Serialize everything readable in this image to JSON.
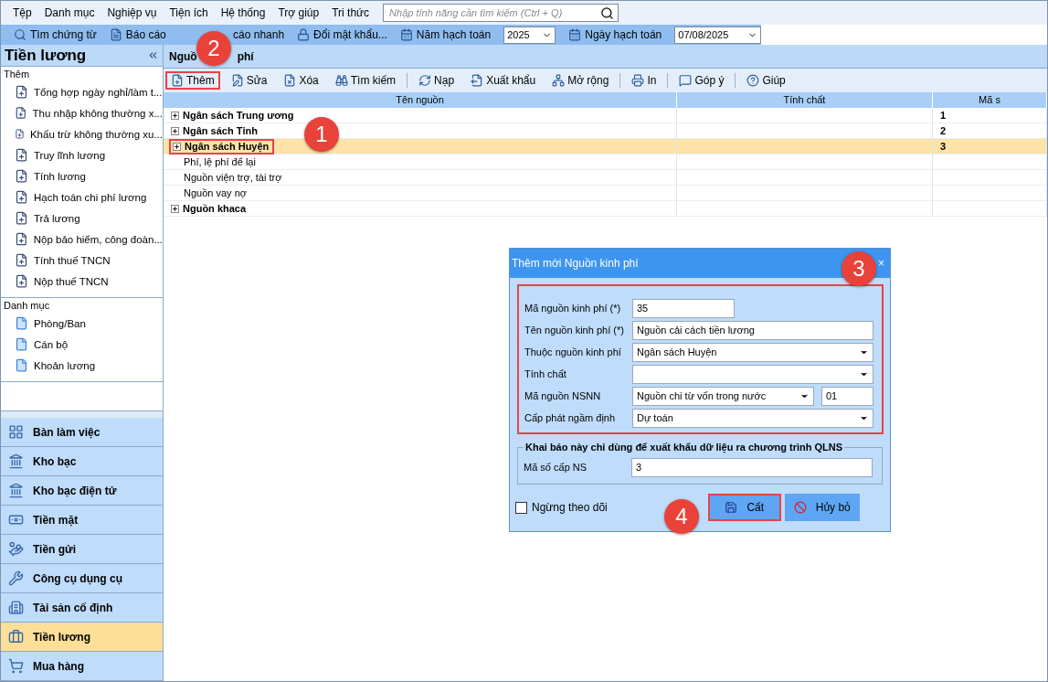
{
  "menu": {
    "items": [
      "Tệp",
      "Danh mục",
      "Nghiệp vụ",
      "Tiện ích",
      "Hệ thống",
      "Trợ giúp",
      "Tri thức"
    ],
    "search": {
      "placeholder": "Nhập tính năng cần tìm kiếm (Ctrl + Q)"
    }
  },
  "toolbar": [
    {
      "kind": "button",
      "label": "Tìm chứng từ"
    },
    {
      "kind": "button",
      "label": "Báo cáo"
    },
    {
      "kind": "covered",
      "label": "cáo nhanh"
    },
    {
      "kind": "button",
      "label": "Đổi mật khẩu..."
    },
    {
      "kind": "combo",
      "label": "Năm hạch toán",
      "value": "2025"
    },
    {
      "kind": "combo",
      "label": "Ngày hạch toán",
      "value": "07/08/2025"
    }
  ],
  "sidebar": {
    "title": "Tiền lương",
    "groups": [
      {
        "heading": "Thêm",
        "items": [
          "Tổng hợp ngày nghỉ/làm t...",
          "Thu nhập không thường x...",
          "Khấu trừ không thường xu...",
          "Truy lĩnh lương",
          "Tính lương",
          "Hạch toán chi phí lương",
          "Trả lương",
          "Nộp bảo hiểm, công đoàn...",
          "Tính thuế TNCN",
          "Nộp thuế TNCN"
        ]
      },
      {
        "heading": "Danh mục",
        "items": [
          "Phòng/Ban",
          "Cán bộ",
          "Khoản lương"
        ]
      }
    ],
    "nav": [
      {
        "label": "Bàn làm việc",
        "selected": false
      },
      {
        "label": "Kho bạc",
        "selected": false
      },
      {
        "label": "Kho bạc điện tử",
        "selected": false
      },
      {
        "label": "Tiền mặt",
        "selected": false
      },
      {
        "label": "Tiền gửi",
        "selected": false
      },
      {
        "label": "Công cụ dụng cụ",
        "selected": false
      },
      {
        "label": "Tài sản cố định",
        "selected": false
      },
      {
        "label": "Tiền lương",
        "selected": true
      },
      {
        "label": "Mua hàng",
        "selected": false
      }
    ]
  },
  "panel": {
    "title_parts": [
      "Nguồ",
      "phí"
    ],
    "toolbar": [
      {
        "label": "Thêm",
        "highlighted": true
      },
      {
        "label": "Sửa",
        "highlighted": false
      },
      {
        "label": "Xóa",
        "highlighted": false
      },
      {
        "label": "Tìm kiếm",
        "highlighted": false
      },
      {
        "label": "Nạp",
        "highlighted": false
      },
      {
        "label": "Xuất khẩu",
        "highlighted": false
      },
      {
        "label": "Mở rộng",
        "highlighted": false
      },
      {
        "label": "In",
        "highlighted": false
      },
      {
        "label": "Góp ý",
        "highlighted": false
      },
      {
        "label": "Giúp",
        "highlighted": false
      }
    ],
    "columns": [
      "Tên nguồn",
      "Tính chất",
      "Mã s"
    ],
    "rows": [
      {
        "kind": "group",
        "name": "Ngân sách Trung ương",
        "code": "1",
        "selected": false,
        "highlighted": false
      },
      {
        "kind": "group",
        "name": "Ngân sách Tỉnh",
        "code": "2",
        "selected": false,
        "highlighted": false
      },
      {
        "kind": "group",
        "name": "Ngân sách Huyện",
        "code": "3",
        "selected": true,
        "highlighted": true
      },
      {
        "kind": "leaf",
        "name": "Phí, lệ phí để lại",
        "selected": false,
        "highlighted": false
      },
      {
        "kind": "leaf",
        "name": "Nguồn viện trợ, tài trợ",
        "selected": false,
        "highlighted": false
      },
      {
        "kind": "leaf",
        "name": "Nguồn vay nợ",
        "selected": false,
        "highlighted": false
      },
      {
        "kind": "group",
        "name": "Nguồn khaca",
        "selected": false,
        "highlighted": false
      }
    ]
  },
  "dialog": {
    "title": "Thêm mới Nguồn kinh phí",
    "close": "×",
    "fields_highlighted": true,
    "fields": [
      {
        "kind": "text",
        "label": "Mã nguồn kinh phí (*)",
        "value": "35"
      },
      {
        "kind": "text",
        "label": "Tên nguồn kinh phí (*)",
        "value": "Nguồn cải cách tiền lương"
      },
      {
        "kind": "select",
        "label": "Thuộc nguồn kinh phí",
        "value": "Ngân sách Huyện"
      },
      {
        "kind": "select",
        "label": "Tính chất"
      },
      {
        "kind": "select_code",
        "label": "Mã nguồn NSNN",
        "value": "Nguồn chi từ vốn trong nước",
        "code": "01"
      },
      {
        "kind": "select",
        "label": "Cấp phát ngầm định",
        "value": "Dự toán"
      }
    ],
    "group": {
      "title": "Khai báo này chỉ dùng để xuất khẩu dữ liệu ra chương trình QLNS",
      "label": "Mã số cấp NS",
      "value": "3"
    },
    "checkbox": {
      "label": "Ngừng theo dõi",
      "checked": false
    },
    "buttons": [
      {
        "kind": "save",
        "label": "Cất",
        "highlighted": true
      },
      {
        "kind": "cancel",
        "label": "Hủy bỏ",
        "highlighted": false
      }
    ]
  },
  "annotations": [
    {
      "label": "1"
    },
    {
      "label": "2"
    },
    {
      "label": "3"
    },
    {
      "label": "4"
    }
  ]
}
